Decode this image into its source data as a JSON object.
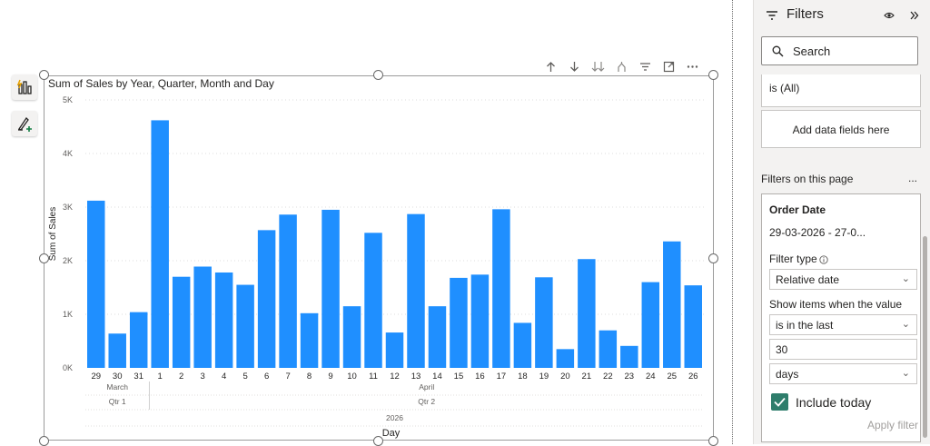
{
  "visual_toolbar": [
    "arrow-up-icon",
    "arrow-down-icon",
    "double-arrow-down-icon",
    "fork-icon",
    "filter-icon",
    "focus-mode-icon",
    "more-options-icon"
  ],
  "filters_pane": {
    "title": "Filters",
    "search_placeholder": "Search",
    "visual_filter_value": "is (All)",
    "add_fields": "Add data fields here",
    "page_filters_label": "Filters on this page",
    "page_filters_more": "...",
    "card": {
      "field": "Order Date",
      "summary": "29-03-2026 - 27-0...",
      "filter_type_label": "Filter type",
      "filter_type_value": "Relative date",
      "show_items_label": "Show items when the value",
      "condition": "is in the last",
      "amount": "30",
      "unit": "days",
      "include_today": "Include today",
      "apply": "Apply filter"
    }
  },
  "chart_data": {
    "type": "bar",
    "title": "Sum of Sales by Year, Quarter, Month and Day",
    "xlabel": "Day",
    "ylabel": "Sum of Sales",
    "ylim": [
      0,
      5000
    ],
    "yticks": [
      "0K",
      "1K",
      "2K",
      "3K",
      "4K",
      "5K"
    ],
    "grid": true,
    "color": "#1f8fff",
    "categories": [
      "29",
      "30",
      "31",
      "1",
      "2",
      "3",
      "4",
      "5",
      "6",
      "7",
      "8",
      "9",
      "10",
      "11",
      "12",
      "13",
      "14",
      "15",
      "16",
      "17",
      "18",
      "19",
      "20",
      "21",
      "22",
      "23",
      "24",
      "25",
      "26"
    ],
    "values": [
      3120,
      640,
      1040,
      4620,
      1700,
      1890,
      1780,
      1550,
      2570,
      2860,
      1020,
      2950,
      1150,
      2520,
      660,
      2870,
      1150,
      1680,
      1740,
      2960,
      840,
      1690,
      350,
      2030,
      700,
      410,
      1600,
      2360,
      1540
    ],
    "months": [
      {
        "label": "March",
        "count": 3
      },
      {
        "label": "April",
        "count": 26
      }
    ],
    "quarters": [
      {
        "label": "Qtr 1",
        "count": 3
      },
      {
        "label": "Qtr 2",
        "count": 26
      }
    ],
    "years": [
      {
        "label": "2026",
        "count": 29
      }
    ]
  }
}
